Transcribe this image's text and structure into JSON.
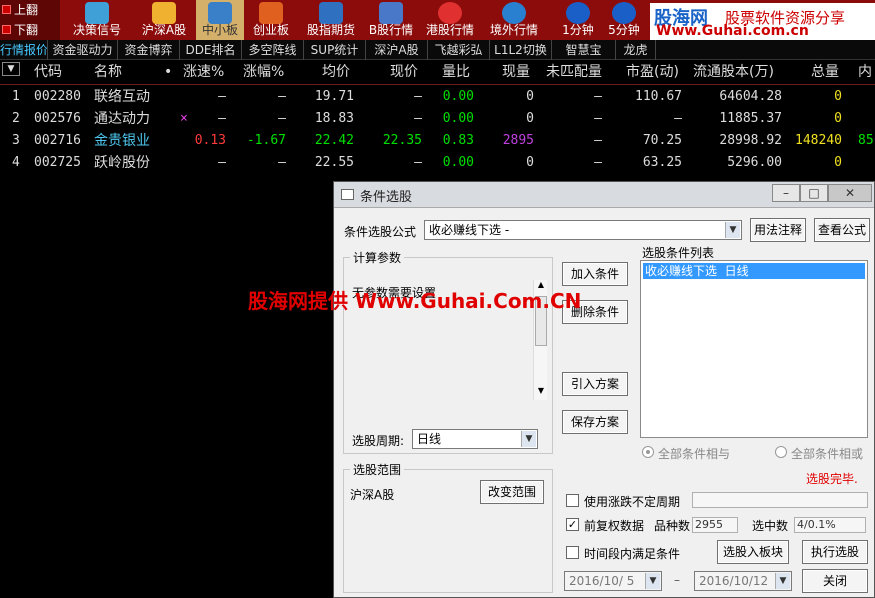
{
  "pager": {
    "up": "上翻",
    "down": "下翻"
  },
  "toolbar": [
    {
      "label": "决策信号",
      "color": "#3fa0d8"
    },
    {
      "label": "沪深A股",
      "color": "#f0b030"
    },
    {
      "label": "中小板",
      "color": "#3a80c8"
    },
    {
      "label": "创业板",
      "color": "#e06020"
    },
    {
      "label": "股指期货",
      "color": "#3070c0"
    },
    {
      "label": "B股行情",
      "color": "#4a78c8"
    },
    {
      "label": "港股行情",
      "color": "#e03030"
    },
    {
      "label": "境外行情",
      "color": "#2a80d0"
    },
    {
      "label": "1分钟",
      "color": "#1a5fc8"
    },
    {
      "label": "5分钟",
      "color": "#1a5fc8"
    }
  ],
  "brand": {
    "name": "股海网",
    "slogan": "股票软件资源分享",
    "url": "Www.Guhai.com.cn"
  },
  "tabs": [
    "行情报价",
    "资金驱动力",
    "资金博弈",
    "DDE排名",
    "多空阵线",
    "SUP统计",
    "深沪A股",
    "飞越彩弘",
    "L1L2切换",
    "智慧宝",
    "龙虎"
  ],
  "table": {
    "headers": [
      "代码",
      "名称",
      "•",
      "涨速%",
      "涨幅%",
      "均价",
      "现价",
      "量比",
      "现量",
      "未匹配量",
      "市盈(动)",
      "流通股本(万)",
      "总量",
      "内"
    ],
    "rows": [
      {
        "idx": "1",
        "code": "002280",
        "name": "联络互动",
        "mark": "",
        "speed": "–",
        "chg": "–",
        "avg": "19.71",
        "price": "–",
        "volr": "0.00",
        "curvol": "0",
        "unm": "–",
        "pe": "110.67",
        "float": "64604.28",
        "total": "0",
        "inner": ""
      },
      {
        "idx": "2",
        "code": "002576",
        "name": "通达动力",
        "mark": "×",
        "speed": "–",
        "chg": "–",
        "avg": "18.83",
        "price": "–",
        "volr": "0.00",
        "curvol": "0",
        "unm": "–",
        "pe": "–",
        "float": "11885.37",
        "total": "0",
        "inner": ""
      },
      {
        "idx": "3",
        "code": "002716",
        "name": "金贵银业",
        "mark": "",
        "speed": "0.13",
        "chg": "-1.67",
        "avg": "22.42",
        "price": "22.35",
        "volr": "0.83",
        "curvol": "2895",
        "unm": "–",
        "pe": "70.25",
        "float": "28998.92",
        "total": "148240",
        "inner": "85"
      },
      {
        "idx": "4",
        "code": "002725",
        "name": "跃岭股份",
        "mark": "",
        "speed": "–",
        "chg": "–",
        "avg": "22.55",
        "price": "–",
        "volr": "0.00",
        "curvol": "0",
        "unm": "–",
        "pe": "63.25",
        "float": "5296.00",
        "total": "0",
        "inner": ""
      }
    ]
  },
  "dialog": {
    "title": "条件选股",
    "formula_label": "条件选股公式",
    "formula_value": "收必赚线下选 -",
    "usage_button": "用法注释",
    "view_button": "查看公式",
    "params_group": "计算参数",
    "params_text": "无参数需要设置",
    "period_label": "选股周期:",
    "period_value": "日线",
    "add_button": "加入条件",
    "delete_button": "删除条件",
    "import_button": "引入方案",
    "save_button": "保存方案",
    "list_label": "选股条件列表",
    "list_items": [
      "收必赚线下选  日线"
    ],
    "radio_and": "全部条件相与",
    "radio_or": "全部条件相或",
    "status": "选股完毕.",
    "range_group": "选股范围",
    "range_value": "沪深A股",
    "change_range_button": "改变范围",
    "chk_uncertain": "使用涨跌不定周期",
    "chk_adjusted": "前复权数据",
    "varieties_label": "品种数",
    "varieties_value": "2955",
    "selected_label": "选中数",
    "selected_value": "4/0.1%",
    "chk_interval": "时间段内满足条件",
    "to_block_button": "选股入板块",
    "execute_button": "执行选股",
    "close_button": "关闭",
    "date_from": "2016/10/ 5",
    "date_sep": "–",
    "date_to": "2016/10/12"
  },
  "watermark": "股海网提供 Www.Guhai.Com.CN",
  "colors": {
    "toolbar_bg": "#8c0b0b",
    "up": "#ff3b3b",
    "down": "#00e000",
    "cyan": "#4ec8f0",
    "yellow": "#f0e020",
    "purple": "#c040e0"
  }
}
